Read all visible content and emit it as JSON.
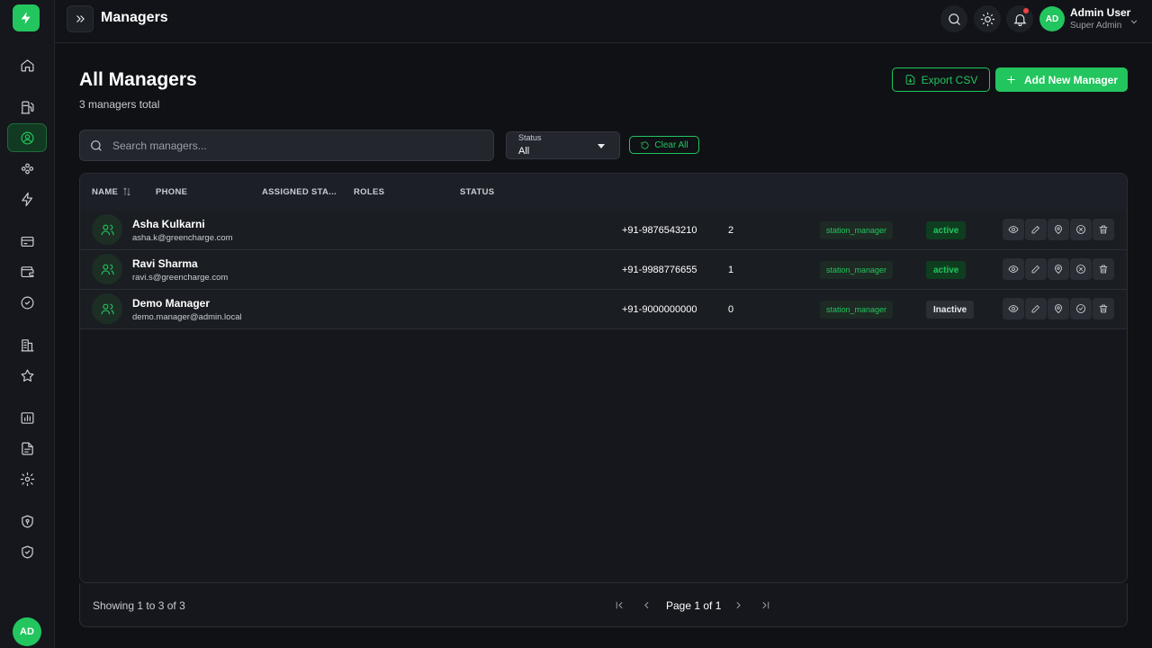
{
  "header": {
    "title": "Managers",
    "user": {
      "initials": "AD",
      "name": "Admin User",
      "role": "Super Admin"
    }
  },
  "sidebar": {
    "icons": [
      "home-icon",
      "fuel-station-icon",
      "manager-icon",
      "users-group-icon",
      "bolt-icon",
      "card-icon",
      "wallet-icon",
      "badge-icon",
      "building-icon",
      "star-icon",
      "chart-icon",
      "file-icon",
      "gear-icon",
      "shield-lock-icon",
      "shield-check-icon"
    ],
    "active": "manager-icon",
    "avatar_initials": "AD"
  },
  "page": {
    "heading": "All Managers",
    "total_text": "3 managers total",
    "export_label": "Export CSV",
    "add_label": "Add New Manager"
  },
  "filters": {
    "search_placeholder": "Search managers...",
    "status_label": "Status",
    "status_value": "All",
    "clear_label": "Clear All"
  },
  "table": {
    "columns": [
      "NAME",
      "PHONE",
      "ASSIGNED STA...",
      "ROLES",
      "STATUS"
    ],
    "rows": [
      {
        "name": "Asha Kulkarni",
        "email": "asha.k@greencharge.com",
        "phone": "+91-9876543210",
        "assigned": "2",
        "role": "station_manager",
        "status": "active"
      },
      {
        "name": "Ravi Sharma",
        "email": "ravi.s@greencharge.com",
        "phone": "+91-9988776655",
        "assigned": "1",
        "role": "station_manager",
        "status": "active"
      },
      {
        "name": "Demo Manager",
        "email": "demo.manager@admin.local",
        "phone": "+91-9000000000",
        "assigned": "0",
        "role": "station_manager",
        "status": "Inactive"
      }
    ]
  },
  "pagination": {
    "showing": "Showing 1 to 3 of 3",
    "page_text": "Page 1 of 1"
  },
  "colors": {
    "accent": "#22c55e",
    "background": "#0f1115",
    "danger_dot": "#ef4444"
  }
}
